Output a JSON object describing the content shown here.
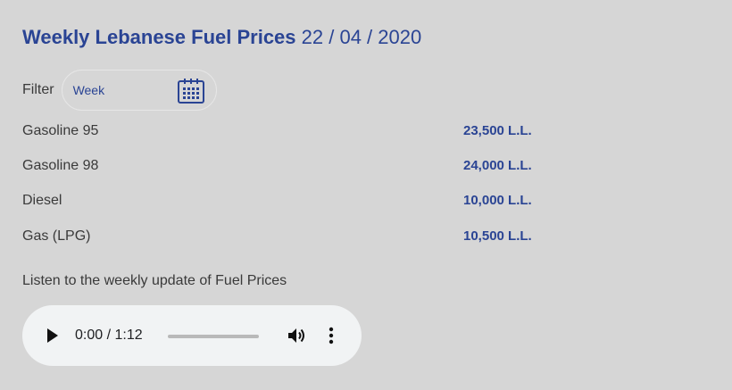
{
  "header": {
    "title": "Weekly Lebanese Fuel Prices",
    "date": "22 / 04 / 2020"
  },
  "filter": {
    "label": "Filter",
    "value": "Week",
    "icon": "calendar-icon"
  },
  "prices": [
    {
      "name": "Gasoline 95",
      "price": "23,500 L.L."
    },
    {
      "name": "Gasoline 98",
      "price": "24,000 L.L."
    },
    {
      "name": "Diesel",
      "price": "10,000 L.L."
    },
    {
      "name": "Gas (LPG)",
      "price": "10,500 L.L."
    }
  ],
  "audio": {
    "caption": "Listen to the weekly update of Fuel Prices",
    "time": "0:00 / 1:12",
    "progress": 0
  },
  "colors": {
    "accent": "#2a4494",
    "background": "#d6d6d6",
    "player_bg": "#f1f3f4"
  }
}
